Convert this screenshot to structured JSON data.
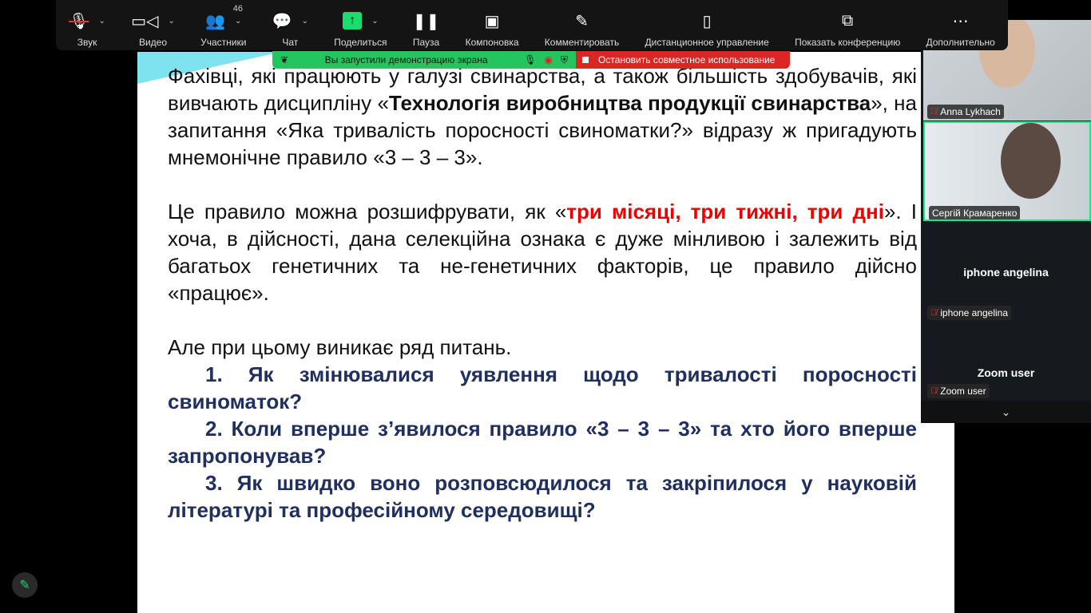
{
  "toolbar": {
    "items": [
      {
        "label": "Звук",
        "icon": "mic-muted-icon"
      },
      {
        "label": "Видео",
        "icon": "video-icon"
      },
      {
        "label": "Участники",
        "icon": "participants-icon",
        "count": "46"
      },
      {
        "label": "Чат",
        "icon": "chat-icon"
      },
      {
        "label": "Поделиться",
        "icon": "share-screen-icon"
      },
      {
        "label": "Пауза",
        "icon": "pause-icon"
      },
      {
        "label": "Компоновка",
        "icon": "layout-icon"
      },
      {
        "label": "Комментировать",
        "icon": "annotate-icon"
      },
      {
        "label": "Дистанционное управление",
        "icon": "remote-control-icon"
      },
      {
        "label": "Показать конференцию",
        "icon": "show-meeting-icon"
      },
      {
        "label": "Дополнительно",
        "icon": "more-icon"
      }
    ]
  },
  "sharebar": {
    "message": "Вы запустили демонстрацию экрана",
    "stop": "Остановить совместное использование",
    "accent_green": "#22c55e",
    "accent_red": "#dc2626"
  },
  "slide": {
    "p1a": "Фахівці, які працюють у галузі свинарства, а також більшість здобувачів, які вивчають дисципліну «",
    "p1b": "Технологія виробництва продукції свинарства",
    "p1c": "», на запитання «Яка тривалість поросності свиноматки?» відразу ж пригадують мнемонічне правило «3 – 3 – 3».",
    "p2a": "Це правило можна розшифрувати, як «",
    "p2b": "три місяці, три тижні, три дні",
    "p2c": "». І хоча, в дійсності, дана селекційна ознака є дуже мінливою і залежить від багатьох генетичних та не-генетичних факторів, це правило дійсно «працює».",
    "p3": "Але при цьому виникає ряд питань.",
    "questions": [
      "1. Як змінювалися уявлення щодо тривалості поросності свиноматок?",
      "2. Коли вперше з’явилося правило «3 – 3 – 3» та хто його вперше запропонував?",
      "3. Як швидко воно розповсюдилося та закріпилося у науковій літературі та професійному середовищі?"
    ]
  },
  "participants": [
    {
      "name": "Anna Lykhach"
    },
    {
      "name": "Сергій Крамаренко"
    },
    {
      "name": "iphone angelina"
    },
    {
      "name": "Zoom user"
    }
  ]
}
